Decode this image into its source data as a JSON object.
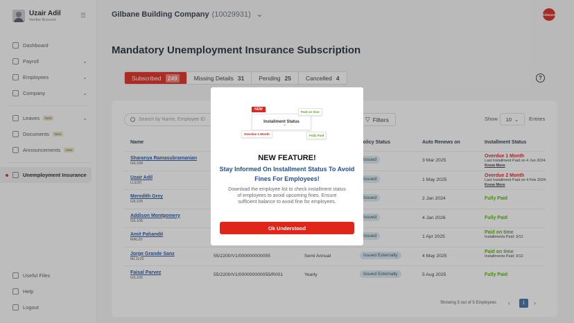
{
  "user": {
    "name": "Uzair Adil",
    "role": "Verifier Account"
  },
  "header": {
    "company": "Gilbane Building Company",
    "company_id": "(10029931)",
    "logo_text": "Sidemed"
  },
  "sidebar": {
    "items": [
      {
        "label": "Dashboard"
      },
      {
        "label": "Payroll"
      },
      {
        "label": "Employees"
      },
      {
        "label": "Company"
      },
      {
        "label": "Leaves",
        "badge": "New"
      },
      {
        "label": "Documents",
        "badge": "New"
      },
      {
        "label": "Announcements",
        "badge": "New"
      },
      {
        "label": "Unemployment Insurance"
      }
    ],
    "bottom": [
      {
        "label": "Useful Files"
      },
      {
        "label": "Help"
      },
      {
        "label": "Logout"
      }
    ]
  },
  "page": {
    "title": "Mandatory Unemployment Insurance Subscription"
  },
  "tabs": [
    {
      "label": "Subscribed",
      "count": "249"
    },
    {
      "label": "Missing Details",
      "count": "31"
    },
    {
      "label": "Pending",
      "count": "25"
    },
    {
      "label": "Cancelled",
      "count": "4"
    }
  ],
  "toolbar": {
    "search_placeholder": "Search by Name, Employee ID",
    "filters_label": "Filters",
    "show_label": "Show",
    "show_value": "10",
    "entries_label": "Entries"
  },
  "table": {
    "headers": {
      "name": "Name",
      "policy_status": "Policy Status",
      "auto_renews": "Auto Renews on",
      "installment_status": "Installment Status"
    },
    "rows": [
      {
        "name": "Sharanya Ramasubramanian",
        "code": "GIL108",
        "policy": "",
        "period": "",
        "status_badge": "Issued",
        "renews": "3 Mar 2025",
        "inst": "Overdue 1 Month",
        "inst_sub": "Last Installment Paid on 4 Jun 2024.",
        "inst_link": "Know More"
      },
      {
        "name": "Uzair Adil",
        "code": "LLE20",
        "policy": "",
        "period": "",
        "status_badge": "Issued",
        "renews": "1 May 2025",
        "inst": "Overdue 2 Month",
        "inst_sub": "Last Installment Paid on 4 Feb 2024.",
        "inst_link": "Know More"
      },
      {
        "name": "Meredith Grey",
        "code": "GIL105",
        "policy": "",
        "period": "",
        "status_badge": "Issued",
        "renews": "2 Jan 2024",
        "inst": "Fully Paid",
        "inst_sub": "",
        "inst_link": ""
      },
      {
        "name": "Addison Montgomery",
        "code": "GIL106",
        "policy": "",
        "period": "",
        "status_badge": "Issued",
        "renews": "4 Jan 2026",
        "inst": "Fully Paid",
        "inst_sub": "",
        "inst_link": ""
      },
      {
        "name": "Amit Pahandit",
        "code": "MAL20",
        "policy": "",
        "period": "",
        "status_badge": "Issued",
        "renews": "1 Apr 2025",
        "inst": "Paid on time",
        "inst_sub": "Installments Paid: 3/12",
        "inst_link": ""
      },
      {
        "name": "Jorge Grande Sanz",
        "code": "ML1120",
        "policy": "55/2200/V1/000000000055",
        "period": "Semi Annual",
        "status_badge": "Issued Externally",
        "renews": "4 May 2025",
        "inst": "Paid on time",
        "inst_sub": "Installments Paid: 3/12",
        "inst_link": ""
      },
      {
        "name": "Faisal Parvez",
        "code": "GIL105",
        "policy": "55/2200/V1/000000000055/R001",
        "period": "Yearly",
        "status_badge": "Issued Externally",
        "renews": "5 Aug 2025",
        "inst": "Fully Paid",
        "inst_sub": "",
        "inst_link": ""
      }
    ]
  },
  "pagination": {
    "summary": "Showing 5 out of 5 Employees",
    "current": "1"
  },
  "modal": {
    "illustration": {
      "new": "NEW",
      "title": "Installment Status",
      "paid_on_time": "Paid on time",
      "overdue": "Overdue 1 Month",
      "fully_paid": "Fully Paid"
    },
    "title": "NEW FEATURE!",
    "subtitle": "Stay Informed On Installment Status To Avoid Fines For Employees!",
    "body": "Download the employee list to check installment status of employees to avoid upcoming fines. Ensure sufficient balance to avoid fine for employees.",
    "button": "Ok Understood"
  }
}
